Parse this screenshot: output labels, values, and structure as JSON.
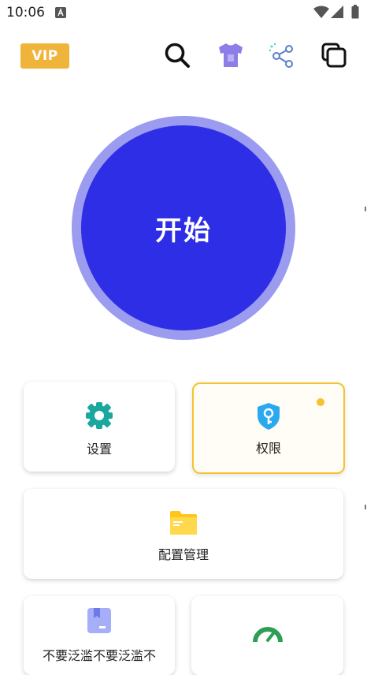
{
  "status_bar": {
    "time": "10:06",
    "notification_icon": "android-a-icon",
    "wifi_icon": "wifi-icon",
    "signal_icon": "signal-icon",
    "battery_icon": "battery-icon"
  },
  "header": {
    "vip_label": "VIP",
    "icons": [
      "search-icon",
      "tshirt-theme-icon",
      "share-icon",
      "copy-windows-icon"
    ]
  },
  "start_button": {
    "label": "开始"
  },
  "cards": {
    "settings": {
      "label": "设置",
      "icon": "gear-icon"
    },
    "permissions": {
      "label": "权限",
      "icon": "shield-key-icon"
    },
    "config": {
      "label": "配置管理",
      "icon": "folder-icon"
    },
    "bottom_left": {
      "label": "不要泛滥不要泛滥不",
      "icon": "bookmark-icon"
    },
    "bottom_right": {
      "icon": "speedometer-icon"
    }
  },
  "colors": {
    "vip": "#f0b43a",
    "start_inner": "#2e2ee6",
    "start_ring": "#9b9bf0",
    "settings_icon": "#1aa89e",
    "permission_icon": "#2aa8f0",
    "permission_border": "#f5c230",
    "folder_icon": "#ffc61a",
    "bookmark_icon": "#9da5f5",
    "speedometer_icon": "#2e9e55"
  }
}
